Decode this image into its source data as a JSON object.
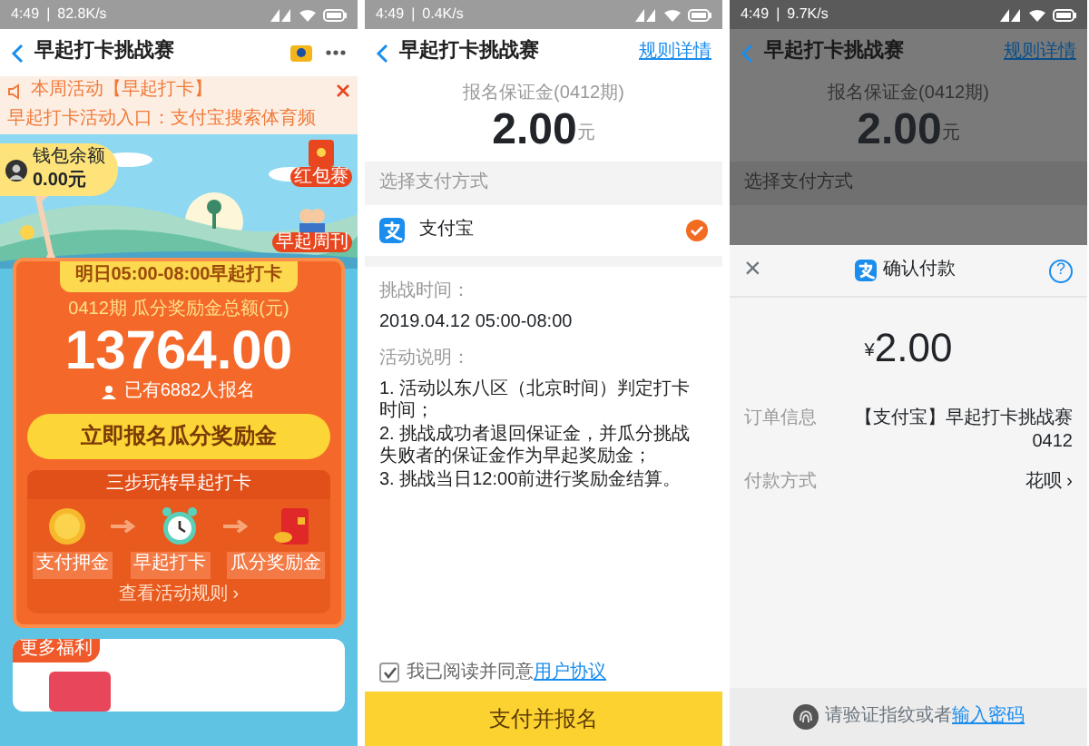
{
  "left_screen": {
    "status_bar": {
      "time": "4:49",
      "separator": "|",
      "speed": "82.8K/s"
    },
    "nav": {
      "title": "早起打卡挑战赛"
    },
    "notice": {
      "texts": [
        "本周活动【早起打卡】",
        "早起打卡活动入口：支付宝搜索体育频"
      ]
    },
    "wallet": {
      "label": "钱包余额",
      "amount": "0.00",
      "unit": "元"
    },
    "side_icons": [
      {
        "label": "红包赛"
      },
      {
        "label": "早起周刊"
      }
    ],
    "card": {
      "tab": "明日05:00-08:00早起打卡",
      "subtitle": "0412期 瓜分奖励金总额(元)",
      "amount": "13764.00",
      "count": "已有6882人报名",
      "button": "立即报名瓜分奖励金",
      "steps_title": "三步玩转早起打卡",
      "steps": [
        {
          "kind": "coin",
          "label": "支付押金"
        },
        {
          "kind": "clock",
          "label": "早起打卡"
        },
        {
          "kind": "envelope",
          "label": "瓜分奖励金"
        }
      ],
      "rules_link": "查看活动规则 ›"
    },
    "more": {
      "tag": "更多福利"
    }
  },
  "middle_screen": {
    "status_bar": {
      "time": "4:49",
      "separator": "|",
      "speed": "0.4K/s"
    },
    "nav": {
      "title": "早起打卡挑战赛",
      "action": "规则详情"
    },
    "deposit": {
      "label": "报名保证金(0412期)",
      "amount": "2.00",
      "unit": "元"
    },
    "payment": {
      "title": "选择支付方式",
      "methods": [
        {
          "name": "支付宝",
          "selected": true
        }
      ]
    },
    "challenge": {
      "label": "挑战时间：",
      "value": "2019.04.12 05:00-08:00"
    },
    "rules": {
      "label": "活动说明：",
      "items": [
        "1. 活动以东八区（北京时间）判定打卡时间；",
        "2. 挑战成功者退回保证金，并瓜分挑战失败者的保证金作为早起奖励金；",
        "3. 挑战当日12:00前进行奖励金结算。"
      ]
    },
    "agreement": {
      "checked": true,
      "text": "我已阅读并同意",
      "link": "用户协议"
    },
    "submit": "支付并报名"
  },
  "right_screen": {
    "status_bar": {
      "time": "4:49",
      "separator": "|",
      "speed": "9.7K/s"
    },
    "nav": {
      "title": "早起打卡挑战赛",
      "action": "规则详情"
    },
    "deposit": {
      "label": "报名保证金(0412期)",
      "amount": "2.00",
      "unit": "元"
    },
    "payment_title": "选择支付方式",
    "sheet": {
      "close": "×",
      "title": "确认付款",
      "help": "?",
      "currency": "¥",
      "amount": "2.00",
      "rows": [
        {
          "label": "订单信息",
          "value": "【支付宝】早起打卡挑战赛 0412"
        },
        {
          "label": "付款方式",
          "value": "花呗 ›"
        }
      ],
      "verify_text": "请验证指纹或者",
      "verify_link": "输入密码"
    }
  }
}
